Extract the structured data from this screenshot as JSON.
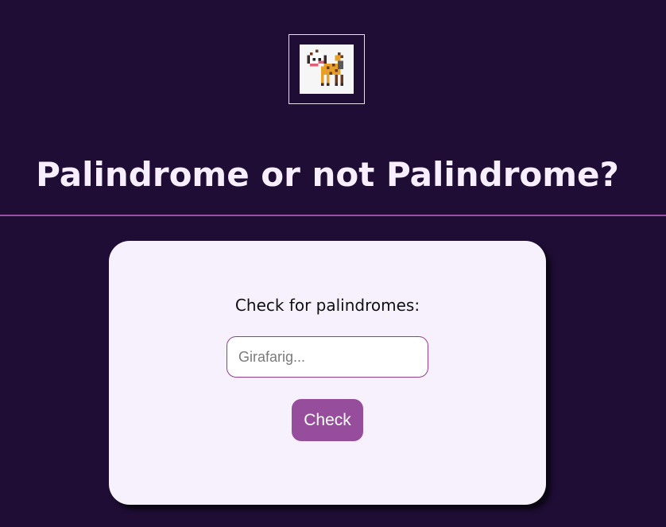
{
  "header": {
    "logo_icon": "girafarig-sprite-icon",
    "title": "Palindrome or not Palindrome?"
  },
  "form": {
    "label": "Check for palindromes:",
    "input_value": "",
    "input_placeholder": "Girafarig...",
    "button_label": "Check"
  },
  "colors": {
    "background": "#1f0d35",
    "title_text": "#f7efff",
    "divider": "#9a4fa0",
    "card": "#f6f1fd",
    "accent": "#964d9c",
    "input_border": "#8e3f93"
  }
}
